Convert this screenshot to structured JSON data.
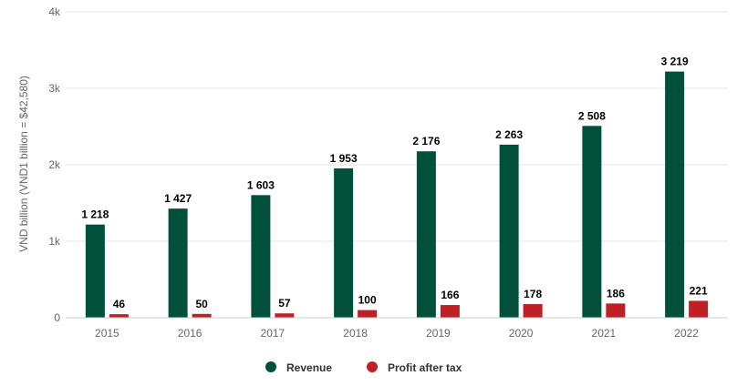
{
  "chart_data": {
    "type": "bar",
    "ylabel": "VND billion (VND1 billion = $42,580)",
    "ylim": [
      0,
      4000
    ],
    "y_ticks": [
      {
        "value": 0,
        "label": "0"
      },
      {
        "value": 1000,
        "label": "1k"
      },
      {
        "value": 2000,
        "label": "2k"
      },
      {
        "value": 3000,
        "label": "3k"
      },
      {
        "value": 4000,
        "label": "4k"
      }
    ],
    "grid": true,
    "legend_position": "bottom-center",
    "categories": [
      "2015",
      "2016",
      "2017",
      "2018",
      "2019",
      "2020",
      "2021",
      "2022"
    ],
    "series": [
      {
        "name": "Revenue",
        "color": "#00503c",
        "values": [
          1218,
          1427,
          1603,
          1953,
          2176,
          2263,
          2508,
          3219
        ],
        "labels": [
          "1 218",
          "1 427",
          "1 603",
          "1 953",
          "2 176",
          "2 263",
          "2 508",
          "3 219"
        ]
      },
      {
        "name": "Profit after tax",
        "color": "#c01f25",
        "values": [
          46,
          50,
          57,
          100,
          166,
          178,
          186,
          221
        ],
        "labels": [
          "46",
          "50",
          "57",
          "100",
          "166",
          "178",
          "186",
          "221"
        ]
      }
    ]
  }
}
